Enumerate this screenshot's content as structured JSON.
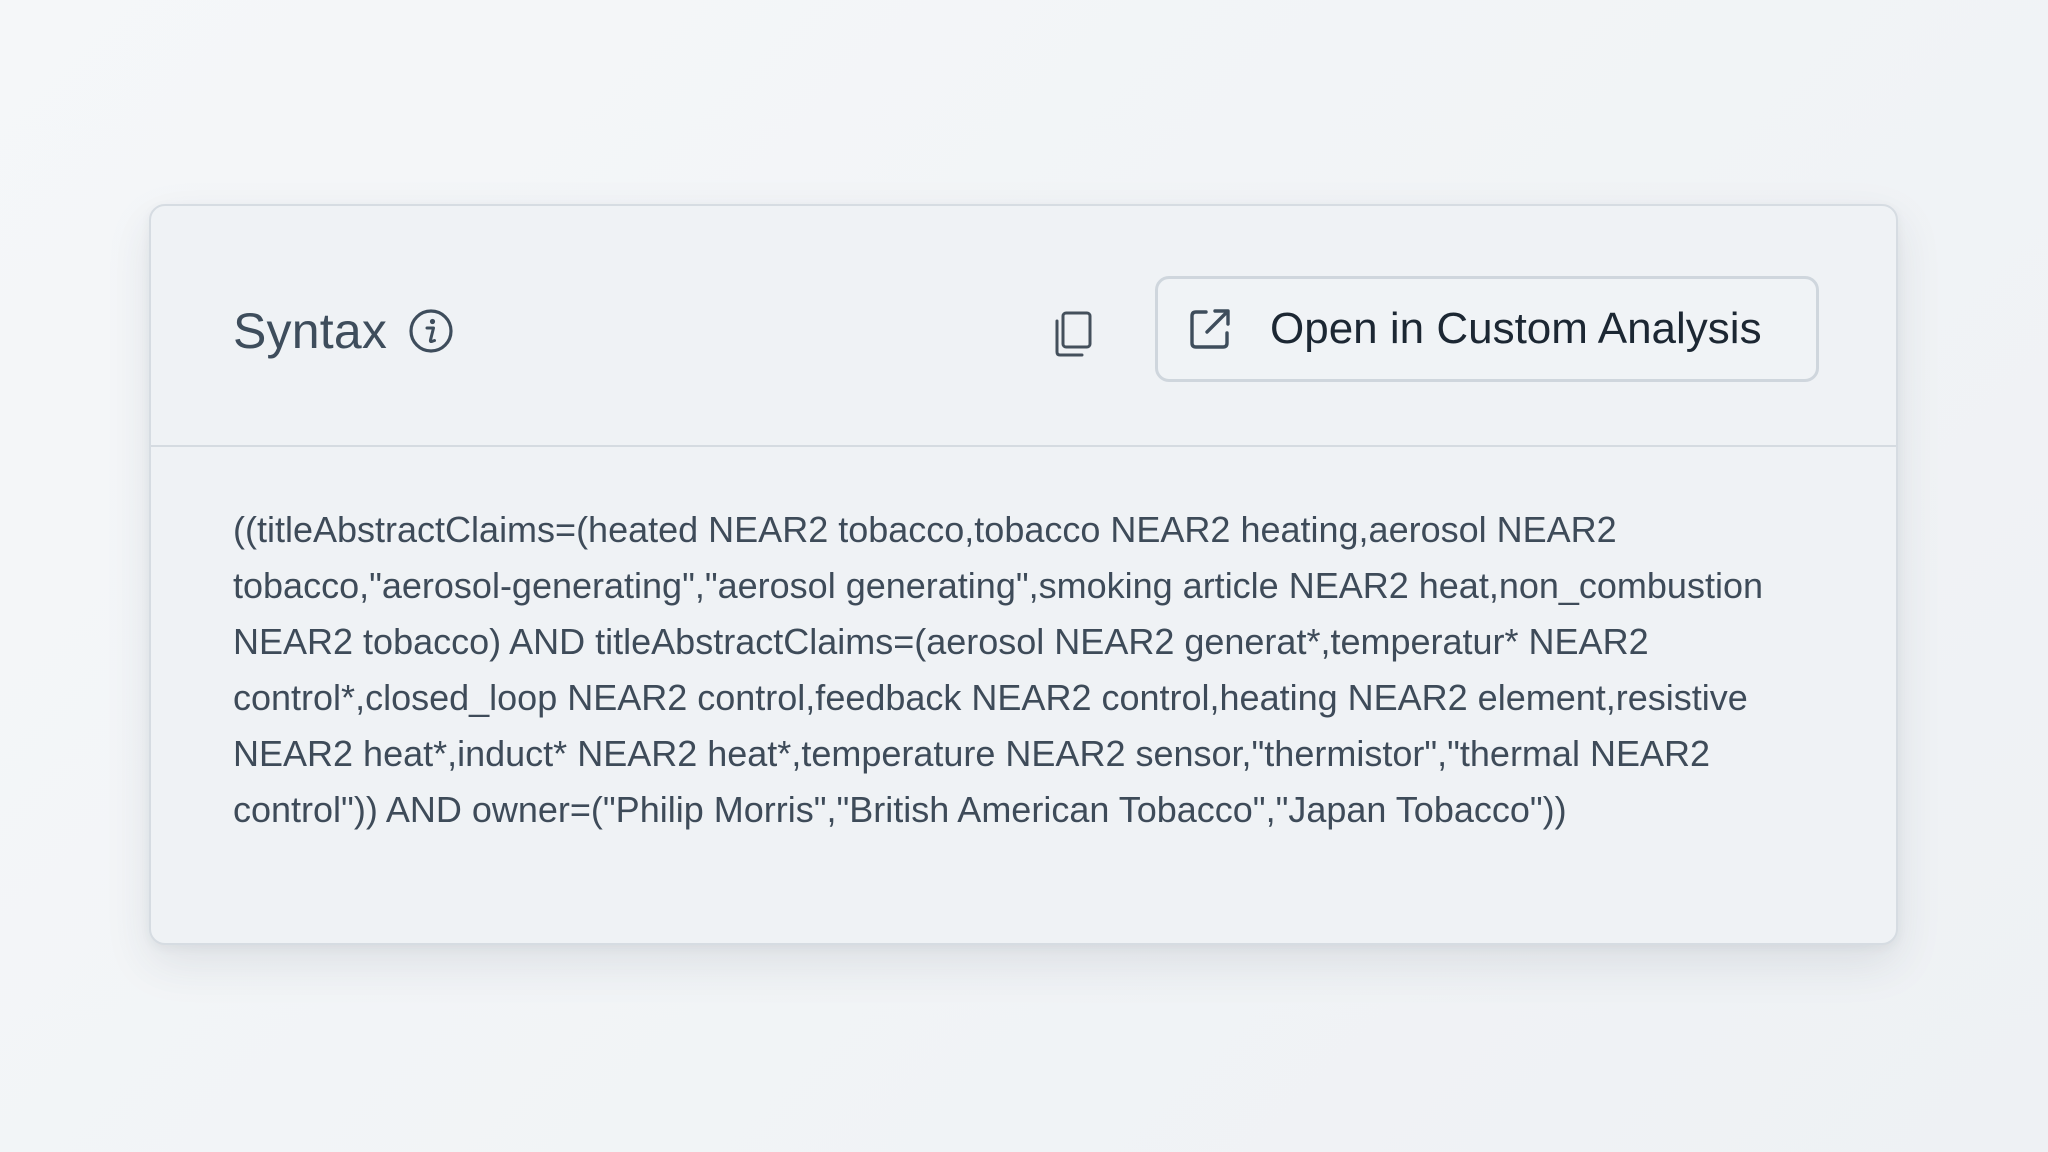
{
  "panel": {
    "title": "Syntax",
    "open_button_label": "Open in Custom Analysis",
    "syntax_text": "((titleAbstractClaims=(heated NEAR2 tobacco,tobacco NEAR2 heating,aerosol NEAR2 tobacco,\"aerosol-generating\",\"aerosol generating\",smoking article NEAR2 heat,non_combustion NEAR2 tobacco) AND titleAbstractClaims=(aerosol NEAR2 generat*,temperatur* NEAR2 control*,closed_loop NEAR2 control,feedback NEAR2 control,heating NEAR2 element,resistive NEAR2 heat*,induct* NEAR2 heat*,temperature NEAR2 sensor,\"thermistor\",\"thermal NEAR2 control\")) AND owner=(\"Philip Morris\",\"British American Tobacco\",\"Japan Tobacco\"))"
  },
  "icons": {
    "info": "info-icon",
    "copy": "copy-icon",
    "open": "external-link-icon"
  },
  "colors": {
    "card_background": "#eff2f5",
    "title_text": "#3e4d5c",
    "button_text": "#1c2733",
    "border": "#d5dbe1"
  }
}
